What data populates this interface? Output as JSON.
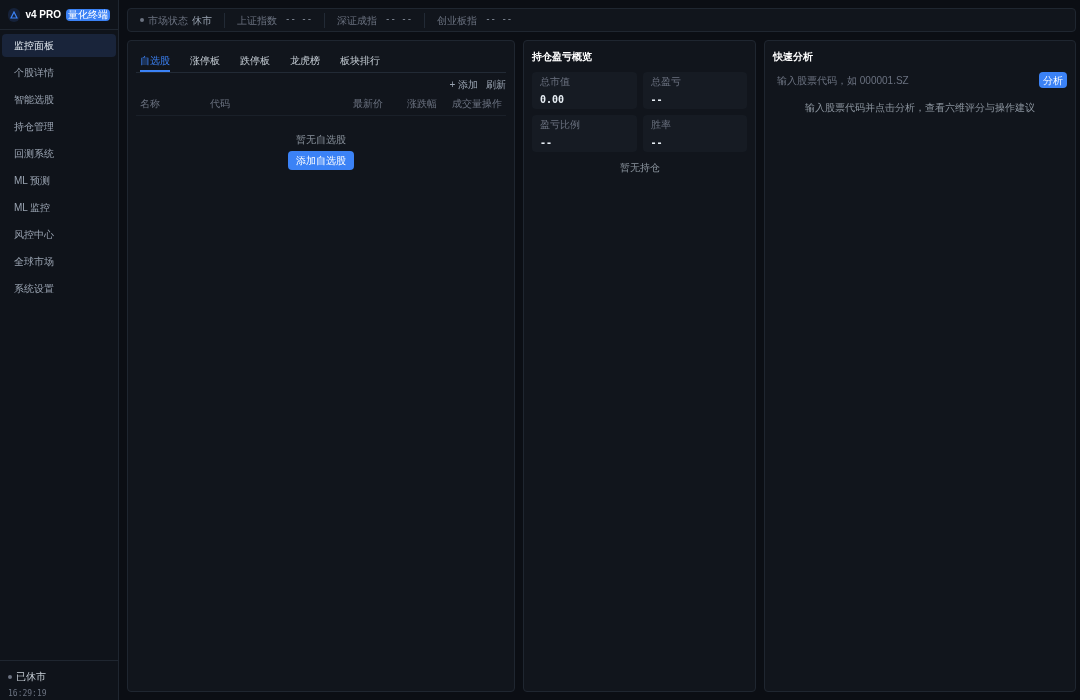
{
  "brand": {
    "name": "v4 PRO",
    "badge": "量化终端"
  },
  "sidebar": {
    "items": [
      {
        "label": "监控面板",
        "selected": true
      },
      {
        "label": "个股详情",
        "selected": false
      },
      {
        "label": "智能选股",
        "selected": false
      },
      {
        "label": "持仓管理",
        "selected": false
      },
      {
        "label": "回测系统",
        "selected": false
      },
      {
        "label": "ML 预测",
        "selected": false
      },
      {
        "label": "ML 监控",
        "selected": false
      },
      {
        "label": "风控中心",
        "selected": false
      },
      {
        "label": "全球市场",
        "selected": false
      },
      {
        "label": "系统设置",
        "selected": false
      }
    ],
    "status": {
      "label": "已休市",
      "time": "16:29:19"
    }
  },
  "top_bar": {
    "market_status": {
      "label": "市场状态",
      "value": "休市"
    },
    "indices": [
      {
        "label": "上证指数",
        "value": "-- --"
      },
      {
        "label": "深证成指",
        "value": "-- --"
      },
      {
        "label": "创业板指",
        "value": "-- --"
      }
    ]
  },
  "watchlist": {
    "tabs": [
      {
        "label": "自选股",
        "selected": true
      },
      {
        "label": "涨停板",
        "selected": false
      },
      {
        "label": "跌停板",
        "selected": false
      },
      {
        "label": "龙虎榜",
        "selected": false
      },
      {
        "label": "板块排行",
        "selected": false
      }
    ],
    "actions": [
      "+ 添加",
      "刷新"
    ],
    "columns": [
      "名称",
      "代码",
      "最新价",
      "涨跌幅",
      "成交量操作"
    ],
    "empty_text": "暂无自选股",
    "add_button": "添加自选股"
  },
  "positions": {
    "title": "持仓盈亏概览",
    "stats": [
      {
        "label": "总市值",
        "value": "0.00"
      },
      {
        "label": "总盈亏",
        "value": "--"
      },
      {
        "label": "盈亏比例",
        "value": "--"
      },
      {
        "label": "胜率",
        "value": "--"
      }
    ],
    "empty_text": "暂无持仓"
  },
  "quick_analysis": {
    "title": "快速分析",
    "placeholder": "输入股票代码，如 000001.SZ",
    "button": "分析",
    "hint": "输入股票代码并点击分析，查看六维评分与操作建议"
  }
}
